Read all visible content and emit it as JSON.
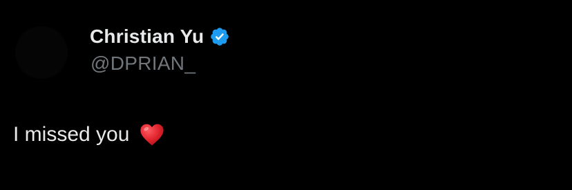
{
  "tweet": {
    "author": {
      "display_name": "Christian Yu",
      "handle": "@DPRIAN_",
      "verified": true,
      "verified_icon": "verified-badge-icon"
    },
    "text": "I missed you",
    "emoji": "heart-icon"
  },
  "colors": {
    "background": "#000000",
    "primary_text": "#e7e9ea",
    "secondary_text": "#71767b",
    "verified_blue": "#1d9bf0",
    "heart_red": "#e0242e"
  }
}
